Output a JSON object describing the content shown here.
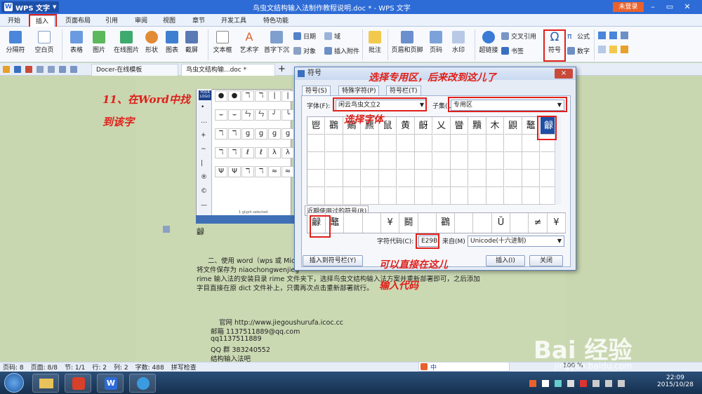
{
  "titlebar": {
    "app_menu": "WPS 文字",
    "doc_title": "鸟虫文结构输入法制作教程说明.doc * - WPS 文字",
    "login": "未登录"
  },
  "menu_tabs": [
    "开始",
    "插入",
    "页面布局",
    "引用",
    "审阅",
    "视图",
    "章节",
    "开发工具",
    "特色功能"
  ],
  "ribbon": {
    "page_break": "分隔符",
    "blank_page": "空白页",
    "table": "表格",
    "picture": "图片",
    "online_picture": "在线图片",
    "shapes": "形状",
    "chart": "图表",
    "screenshot": "截屏",
    "textbox": "文本框",
    "wordart": "艺术字",
    "dropcap": "首字下沉",
    "date": "日期",
    "object": "对象",
    "field": "域",
    "insert_attachment": "插入附件",
    "comment": "批注",
    "header_footer": "页眉和页脚",
    "page_number": "页码",
    "watermark": "水印",
    "hyperlink": "超链接",
    "cross_reference": "交叉引用",
    "bookmark": "书签",
    "symbol": "符号",
    "formula": "公式",
    "number": "数字"
  },
  "doc_tabs": [
    "Docer-在线模板",
    "鸟虫文结构输...doc *"
  ],
  "annotations": {
    "step11_line1": "11、在Word中找",
    "step11_line2": "到该字",
    "choose_private": "选择专用区，后来改到这儿了",
    "choose_font": "选择字体",
    "input_code_line1": "可以直接在这儿",
    "input_code_line2": "输入代码"
  },
  "document": {
    "para1": "二、使用 word（wps 或 Mic",
    "para2": "将文件保存为 niaochongwenjieg",
    "para3": "rime 输入法的安装目录 rime 文件夹下，选择鸟虫文结构输入法方案并重新部署即可，之后添加",
    "para4": "字目直接在原 dict 文件补上，只需再次点击重新部署就行。",
    "site": "官网 http://www.jiegoushurufa.icoc.cc",
    "email": "邮箱 1137511889@qq.com",
    "qq": "qq1137511889",
    "qq_group": "QQ 群 383240552",
    "last": "结构输入法吧"
  },
  "small_panel": {
    "symbols": [
      "●",
      "●",
      "ℸ",
      "ℸ",
      "|",
      "|",
      "⌣",
      "⌣",
      "ㄣ",
      "ㄣ",
      "╯",
      "╰",
      "ℸ",
      "ℸ",
      "ɡ",
      "ɡ",
      "ɡ",
      "ɡ",
      "ℸ",
      "ℸ",
      "ℓ",
      "ℓ",
      "λ",
      "λ",
      "Ψ",
      "Ψ",
      "ℸ",
      "ℸ",
      "≈",
      "≈"
    ],
    "left_col": [
      "•",
      "…",
      "+",
      "~",
      "|",
      "®",
      "©",
      "—"
    ],
    "status": "1 glyph selected"
  },
  "dialog": {
    "title": "符号",
    "close": "×",
    "tabs": [
      "符号(S)",
      "特殊字符(P)",
      "符号栏(T)"
    ],
    "font_label": "字体(F):",
    "font_value": "闲云鸟虫文立2",
    "subset_label": "子集(U):",
    "subset_value": "专用区",
    "grid_row1": [
      "鬯",
      "鸐",
      "鷬",
      "麃",
      "鼠",
      "黄",
      "齖",
      "乂",
      "矕",
      "黷",
      "木",
      "鼰",
      "鼇",
      "龣"
    ],
    "recent_label": "近期使用过的符号(R)",
    "recent": [
      "龣",
      "鼇",
      "",
      "",
      "¥",
      "鬭",
      "",
      "鸐",
      "",
      "",
      "Ŭ",
      "",
      "≠",
      "¥"
    ],
    "code_label": "字符代码(C):",
    "code_value": "E29B",
    "from_label": "来自(M)",
    "from_value": "Unicode(十六进制)",
    "insert_to_bar": "插入到符号栏(Y)",
    "insert": "插入(I)",
    "close_btn": "关闭"
  },
  "statusbar": {
    "page": "页码: 8",
    "pages": "页面: 8/8",
    "section": "节: 1/1",
    "row": "行: 2",
    "col": "列: 2",
    "words": "字数: 488",
    "spell": "拼写检查",
    "zoom": "100 %"
  },
  "taskbar": {
    "time": "22:09",
    "date": "2015/10/28"
  },
  "watermark": {
    "brand": "Bai 经验",
    "url": "jingyan.baidu.com"
  },
  "colors": {
    "accent": "#2d6bd6",
    "annotation": "#e0201a",
    "login": "#e9612c"
  }
}
